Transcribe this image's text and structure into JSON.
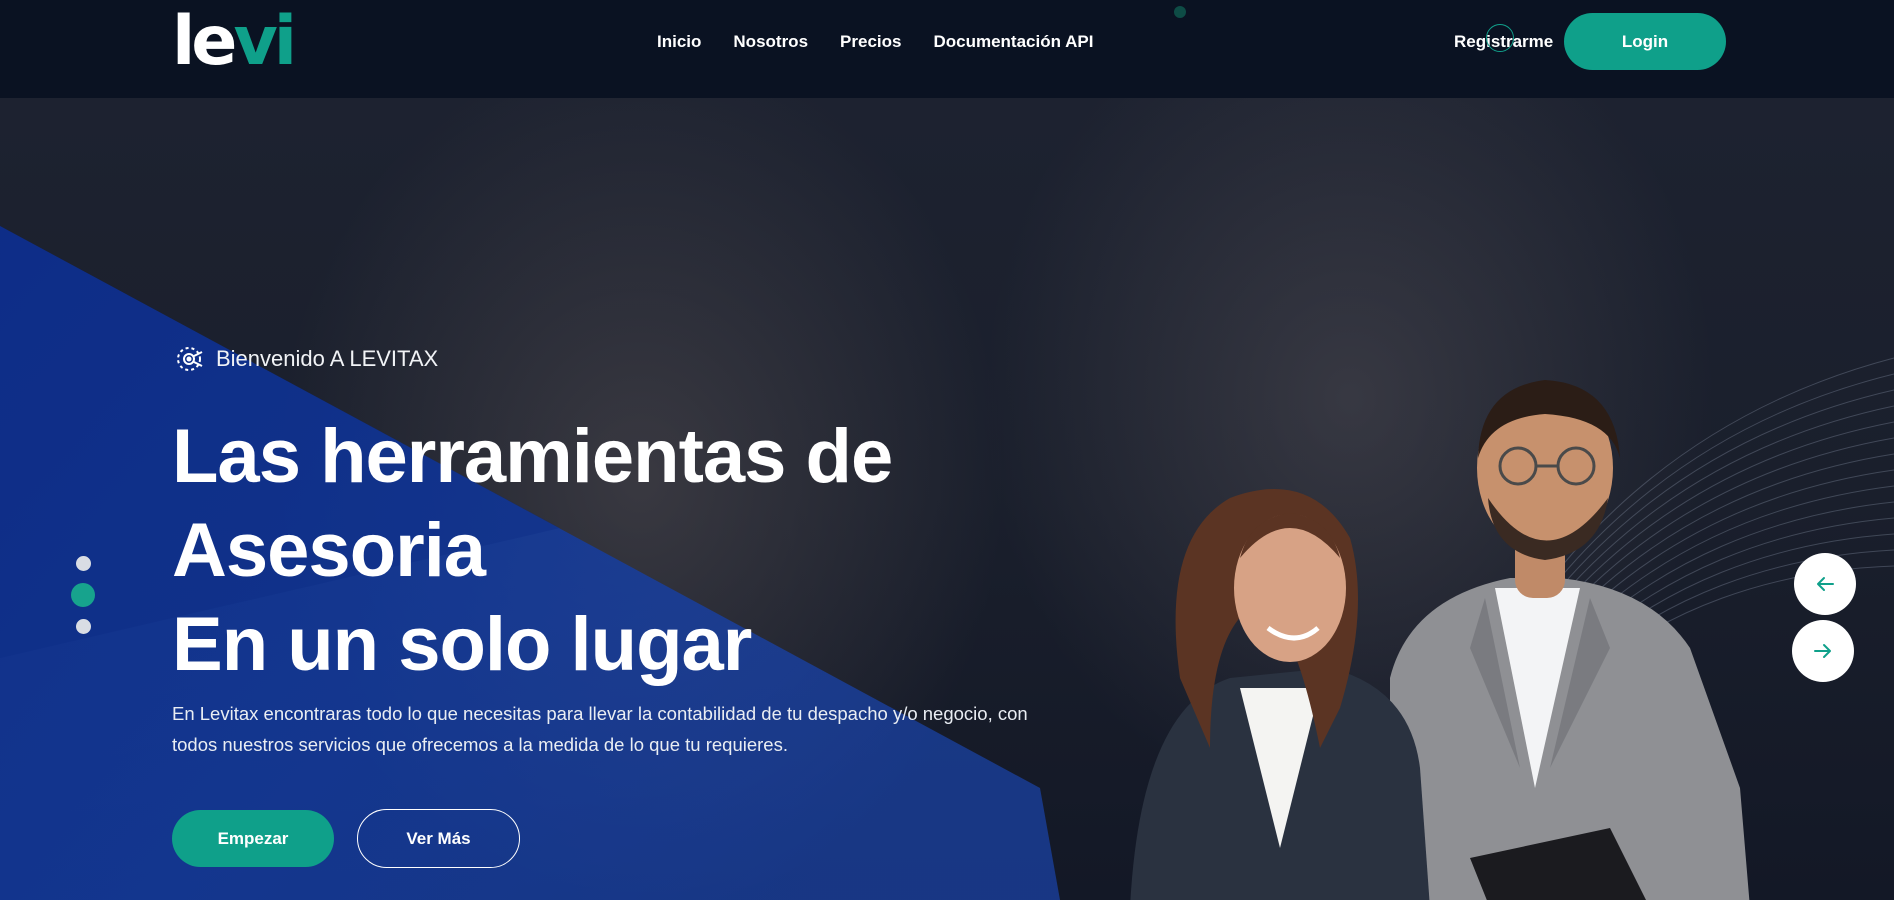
{
  "brand": {
    "logo_part1": "le",
    "logo_part2": "vi"
  },
  "nav": {
    "items": [
      {
        "label": "Inicio"
      },
      {
        "label": "Nosotros"
      },
      {
        "label": "Precios"
      },
      {
        "label": "Documentación API"
      }
    ],
    "register_label": "Registrarme",
    "login_label": "Login"
  },
  "hero": {
    "welcome": "Bienvenido A LEVITAX",
    "title_lines": [
      "Las herramientas de",
      "Asesoria",
      "En un solo lugar"
    ],
    "description": "En Levitax encontraras todo lo que necesitas para llevar la contabilidad de tu despacho y/o negocio, con todos nuestros servicios que ofrecemos a la medida de lo que tu requieres.",
    "start_label": "Empezar",
    "more_label": "Ver Más",
    "slider": {
      "slide_count": 3,
      "active_slide": 2
    },
    "icons": {
      "welcome": "gear-sparkle-icon",
      "prev": "arrow-left-icon",
      "next": "arrow-right-icon"
    }
  },
  "colors": {
    "accent": "#0fa08a",
    "header_bg": "#0a1222",
    "hero_blue": "#10308f",
    "white": "#ffffff"
  }
}
